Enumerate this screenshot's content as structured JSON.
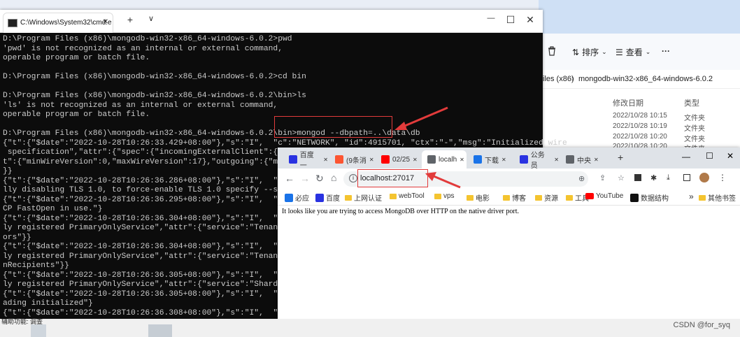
{
  "explorer": {
    "toolbar": {
      "delete_label": "",
      "sort_label": "排序",
      "view_label": "查看",
      "more_label": "···"
    },
    "breadcrumb": {
      "part1": "iles (x86)",
      "sep": "›",
      "part2": "mongodb-win32-x86_64-windows-6.0.2"
    },
    "columns": {
      "modified": "修改日期",
      "type": "类型"
    },
    "rows": [
      {
        "date": "2022/10/28 10:15",
        "type": "文件夹"
      },
      {
        "date": "2022/10/28 10:19",
        "type": "文件夹"
      },
      {
        "date": "2022/10/28 10:20",
        "type": "文件夹"
      },
      {
        "date": "2022/10/28 10:20",
        "type": "文件夹"
      }
    ]
  },
  "cmd": {
    "tab_title": "C:\\Windows\\System32\\cmd.e",
    "add_tab": "+",
    "dropdown": "∨",
    "minimize": "—",
    "maximize": "☐",
    "close": "✕",
    "lines": [
      "D:\\Program Files (x86)\\mongodb-win32-x86_64-windows-6.0.2>pwd",
      "'pwd' is not recognized as an internal or external command,",
      "operable program or batch file.",
      "",
      "D:\\Program Files (x86)\\mongodb-win32-x86_64-windows-6.0.2>cd bin",
      "",
      "D:\\Program Files (x86)\\mongodb-win32-x86_64-windows-6.0.2\\bin>ls",
      "'ls' is not recognized as an internal or external command,",
      "operable program or batch file.",
      "",
      "D:\\Program Files (x86)\\mongodb-win32-x86_64-windows-6.0.2\\bin>mongod --dbpath=..\\data\\db",
      "{\"t\":{\"$date\":\"2022-10-28T10:26:33.429+08:00\"},\"s\":\"I\",  \"c\":\"NETWORK\", \"id\":4915701, \"ctx\":\"-\",\"msg\":\"Initialized wire",
      " specification\",\"attr\":{\"spec\":{\"incomingExternalClient\":{\"minW",
      "t\":{\"minWireVersion\":0,\"maxWireVersion\":17},\"outgoing\":{\"minWi",
      "}}",
      "{\"t\":{\"$date\":\"2022-10-28T10:26:36.286+08:00\"},\"s\":\"I\",  \"c\":\"",
      "lly disabling TLS 1.0, to force-enable TLS 1.0 specify --sslDis",
      "{\"t\":{\"$date\":\"2022-10-28T10:26:36.295+08:00\"},\"s\":\"I\",  \"c\":\"",
      "CP FastOpen in use.\"}",
      "{\"t\":{\"$date\":\"2022-10-28T10:26:36.304+08:00\"},\"s\":\"I\",  \"c\":\"",
      "ly registered PrimaryOnlyService\",\"attr\":{\"service\":\"TenantMigr",
      "ors\"}}",
      "{\"t\":{\"$date\":\"2022-10-28T10:26:36.304+08:00\"},\"s\":\"I\",  \"c\":\"",
      "ly registered PrimaryOnlyService\",\"attr\":{\"service\":\"TenantMigr",
      "nRecipients\"}}",
      "{\"t\":{\"$date\":\"2022-10-28T10:26:36.305+08:00\"},\"s\":\"I\",  \"c\":\"",
      "ly registered PrimaryOnlyService\",\"attr\":{\"service\":\"ShardSplit",
      "{\"t\":{\"$date\":\"2022-10-28T10:26:36.305+08:00\"},\"s\":\"I\",  \"c\":\"",
      "ading initialized\"}",
      "{\"t\":{\"$date\":\"2022-10-28T10:26:36.308+08:00\"},\"s\":\"I\",  \"c\":\""
    ]
  },
  "browser": {
    "tabs": [
      {
        "label": "百度一",
        "icon": "baidu-icon",
        "color": "#2932e1"
      },
      {
        "label": "(9条消",
        "icon": "csdn-icon",
        "color": "#fc5531"
      },
      {
        "label": "02/25",
        "icon": "youtube-icon",
        "color": "#ff0000"
      },
      {
        "label": "localh",
        "icon": "globe-icon",
        "color": "#5f6368"
      },
      {
        "label": "下载",
        "icon": "download-icon",
        "color": "#1a73e8"
      },
      {
        "label": "公务员",
        "icon": "paw-icon",
        "color": "#2932e1"
      },
      {
        "label": "中央",
        "icon": "globe-icon",
        "color": "#5f6368"
      }
    ],
    "new_tab": "+",
    "url": "localhost:27017",
    "bookmarks": [
      {
        "label": "必应",
        "icon": "search-icon"
      },
      {
        "label": "百度",
        "icon": "baidu-icon"
      },
      {
        "label": "上网认证",
        "icon": "folder-icon"
      },
      {
        "label": "webTool",
        "icon": "folder-icon"
      },
      {
        "label": "vps",
        "icon": "folder-icon"
      },
      {
        "label": "电影",
        "icon": "folder-icon"
      },
      {
        "label": "博客",
        "icon": "folder-icon"
      },
      {
        "label": "资源",
        "icon": "folder-icon"
      },
      {
        "label": "工具",
        "icon": "folder-icon"
      },
      {
        "label": "YouTube",
        "icon": "youtube-icon"
      },
      {
        "label": "数据结构",
        "icon": "va-icon"
      }
    ],
    "more_bookmarks": "»",
    "other_bookmarks": "其他书签",
    "message": "It looks like you are trying to access MongoDB over HTTP on the native driver port."
  },
  "taskbar": {
    "help_text": "辅助功能: 调查"
  },
  "watermark": "CSDN @for_syq",
  "colors": {
    "highlight": "#e23b3b",
    "console_bg": "#0c0c0c",
    "console_fg": "#cccccc"
  }
}
